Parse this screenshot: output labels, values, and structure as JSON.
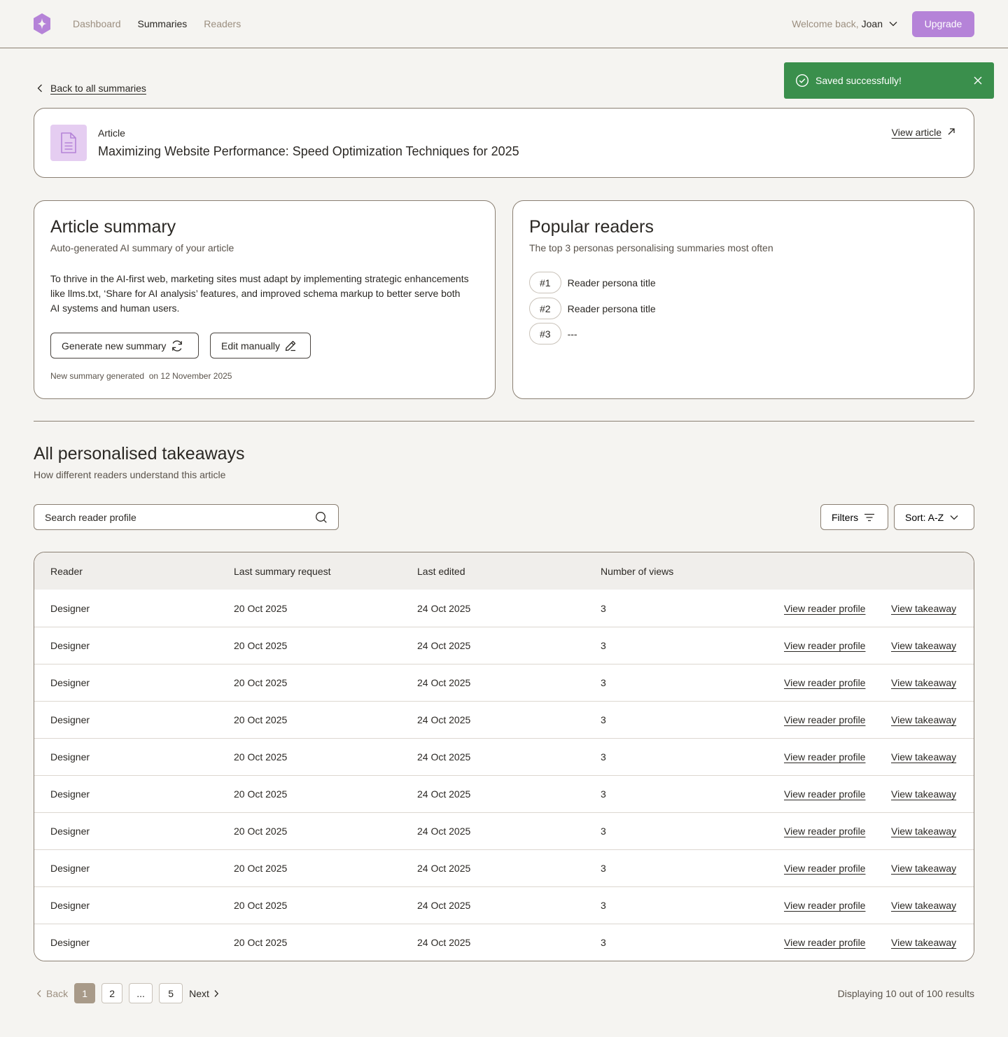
{
  "header": {
    "nav": [
      "Dashboard",
      "Summaries",
      "Readers"
    ],
    "active_nav": "Summaries",
    "welcome": "Welcome back,",
    "username": "Joan",
    "upgrade_label": "Upgrade",
    "brand_color": "#b583d8"
  },
  "toast": {
    "message": "Saved successfully!",
    "color": "#3a8f4c"
  },
  "back_link": "Back to all summaries",
  "article": {
    "label": "Article",
    "title": "Maximizing Website Performance: Speed Optimization Techniques for 2025",
    "view_label": "View article"
  },
  "summary": {
    "title": "Article summary",
    "subtitle": "Auto-generated AI summary of your article",
    "text": "To thrive in the AI-first web, marketing sites must adapt by implementing strategic enhancements like llms.txt, ‘Share for AI analysis’ features, and improved schema markup to better serve both AI systems and human users.",
    "generate_label": "Generate new summary",
    "edit_label": "Edit manually",
    "meta": "New summary generated  on 12 November 2025"
  },
  "popular": {
    "title": "Popular readers",
    "subtitle": "The top 3 personas personalising summaries most often",
    "ranks": [
      {
        "rank": "#1",
        "label": "Reader persona title"
      },
      {
        "rank": "#2",
        "label": "Reader persona title"
      },
      {
        "rank": "#3",
        "label": "---"
      }
    ]
  },
  "takeaways": {
    "title": "All personalised takeaways",
    "subtitle": "How different readers understand this article",
    "search_placeholder": "Search reader profile",
    "filters_label": "Filters",
    "sort_label": "Sort: A-Z",
    "columns": [
      "Reader",
      "Last summary request",
      "Last edited",
      "Number of views"
    ],
    "rows": [
      {
        "reader": "Designer",
        "requested": "20 Oct 2025",
        "edited": "24 Oct 2025",
        "views": "3",
        "profile": "View reader profile",
        "takeaway": "View takeaway"
      },
      {
        "reader": "Designer",
        "requested": "20 Oct 2025",
        "edited": "24 Oct 2025",
        "views": "3",
        "profile": "View reader profile",
        "takeaway": "View takeaway"
      },
      {
        "reader": "Designer",
        "requested": "20 Oct 2025",
        "edited": "24 Oct 2025",
        "views": "3",
        "profile": "View reader profile",
        "takeaway": "View takeaway"
      },
      {
        "reader": "Designer",
        "requested": "20 Oct 2025",
        "edited": "24 Oct 2025",
        "views": "3",
        "profile": "View reader profile",
        "takeaway": "View takeaway"
      },
      {
        "reader": "Designer",
        "requested": "20 Oct 2025",
        "edited": "24 Oct 2025",
        "views": "3",
        "profile": "View reader profile",
        "takeaway": "View takeaway"
      },
      {
        "reader": "Designer",
        "requested": "20 Oct 2025",
        "edited": "24 Oct 2025",
        "views": "3",
        "profile": "View reader profile",
        "takeaway": "View takeaway"
      },
      {
        "reader": "Designer",
        "requested": "20 Oct 2025",
        "edited": "24 Oct 2025",
        "views": "3",
        "profile": "View reader profile",
        "takeaway": "View takeaway"
      },
      {
        "reader": "Designer",
        "requested": "20 Oct 2025",
        "edited": "24 Oct 2025",
        "views": "3",
        "profile": "View reader profile",
        "takeaway": "View takeaway"
      },
      {
        "reader": "Designer",
        "requested": "20 Oct 2025",
        "edited": "24 Oct 2025",
        "views": "3",
        "profile": "View reader profile",
        "takeaway": "View takeaway"
      },
      {
        "reader": "Designer",
        "requested": "20 Oct 2025",
        "edited": "24 Oct 2025",
        "views": "3",
        "profile": "View reader profile",
        "takeaway": "View takeaway"
      }
    ]
  },
  "pagination": {
    "back_label": "Back",
    "pages": [
      "1",
      "2",
      "...",
      "5"
    ],
    "current": "1",
    "next_label": "Next",
    "results_text": "Displaying 10 out of 100 results"
  },
  "icons": [
    "logo-icon",
    "chevron-down-icon",
    "check-circle-icon",
    "close-icon",
    "chevron-left-icon",
    "document-icon",
    "arrow-up-right-icon",
    "refresh-icon",
    "pencil-icon",
    "search-icon",
    "filter-icon",
    "chevron-right-icon"
  ]
}
